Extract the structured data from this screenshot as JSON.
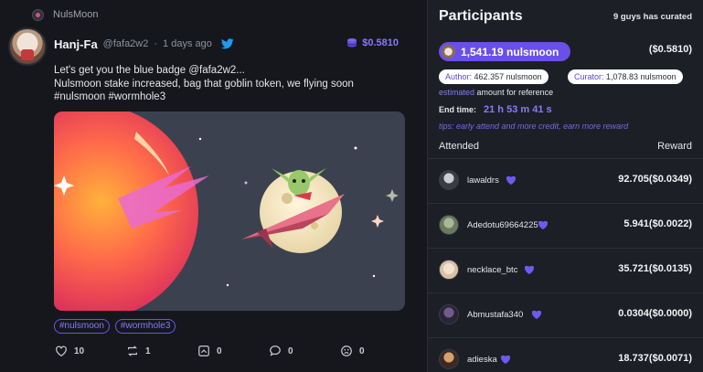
{
  "app": {
    "name": "NulsMoon"
  },
  "post": {
    "author_name": "Hanj-Fa",
    "author_handle": "@fafa2w2",
    "separator": "·",
    "posted_time": "1 days ago",
    "reward": "$0.5810",
    "text_line1": "Let's get you the blue badge @fafa2w2...",
    "text_line2": "Nulsmoon stake increased, bag that goblin token, we flying soon",
    "text_line3": "#nulsmoon #wormhole3",
    "tags": [
      "#nulsmoon",
      "#wormhole3"
    ],
    "actions": [
      {
        "icon": "heart-icon",
        "count": "10"
      },
      {
        "icon": "retweet-icon",
        "count": "1"
      },
      {
        "icon": "quote-icon",
        "count": "0"
      },
      {
        "icon": "comment-icon",
        "count": "0"
      },
      {
        "icon": "frown-icon",
        "count": "0"
      }
    ]
  },
  "participants": {
    "title": "Participants",
    "curated_count": "9 guys has curated",
    "pool_amount": "1,541.19 nulsmoon",
    "pool_usd": "($0.5810)",
    "author_label": "Author:",
    "author_share": "462.357 nulsmoon",
    "curator_label": "Curator:",
    "curator_share": "1,078.83 nulsmoon",
    "estimated_word": "estimated",
    "estimated_rest": "amount for reference",
    "endtime_label": "End time:",
    "endtime_value": "21 h 53 m 41 s",
    "tips": "tips: early attend and more credit, earn more reward",
    "col_attended": "Attended",
    "col_reward": "Reward",
    "rows": [
      {
        "name": "lawaldrs",
        "reward": "92.705($0.0349)"
      },
      {
        "name": "Adedotu69664225",
        "reward": "5.941($0.0022)"
      },
      {
        "name": "necklace_btc",
        "reward": "35.721($0.0135)"
      },
      {
        "name": "Abmustafa340",
        "reward": "0.0304($0.0000)"
      },
      {
        "name": "adieska",
        "reward": "18.737($0.0071)"
      }
    ]
  },
  "colors": {
    "accent": "#6a50e8",
    "accent_text": "#8b78ff",
    "background": "#15171c",
    "panel": "#1c1f26"
  }
}
